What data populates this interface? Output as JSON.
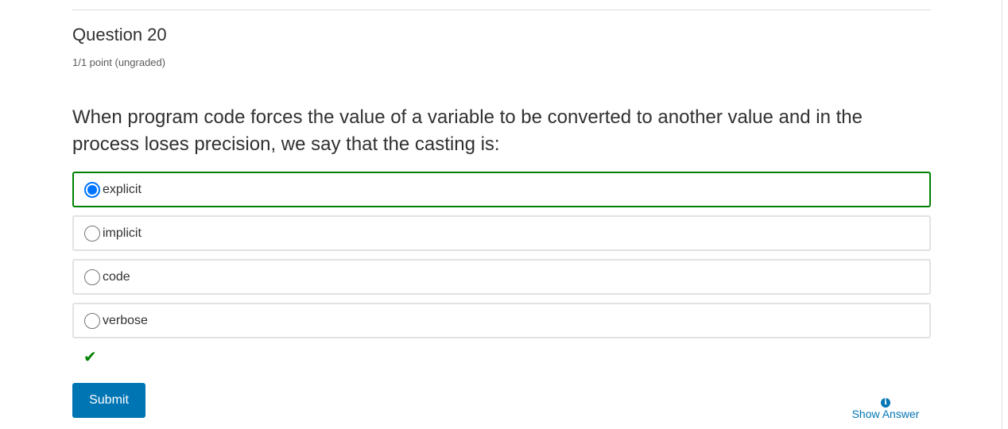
{
  "question": {
    "title": "Question 20",
    "points": "1/1 point (ungraded)",
    "prompt": "When program code forces the value of a variable to be converted to another value and in the process loses precision, we say that the casting is:",
    "options": [
      {
        "label": "explicit",
        "selected": true
      },
      {
        "label": "implicit",
        "selected": false
      },
      {
        "label": "code",
        "selected": false
      },
      {
        "label": "verbose",
        "selected": false
      }
    ],
    "status_icon": "checkmark-icon",
    "submit_label": "Submit",
    "show_answer_label": "Show Answer",
    "info_glyph": "i"
  },
  "colors": {
    "correct": "#008100",
    "accent": "#0075b4",
    "radio": "#0075ff"
  }
}
